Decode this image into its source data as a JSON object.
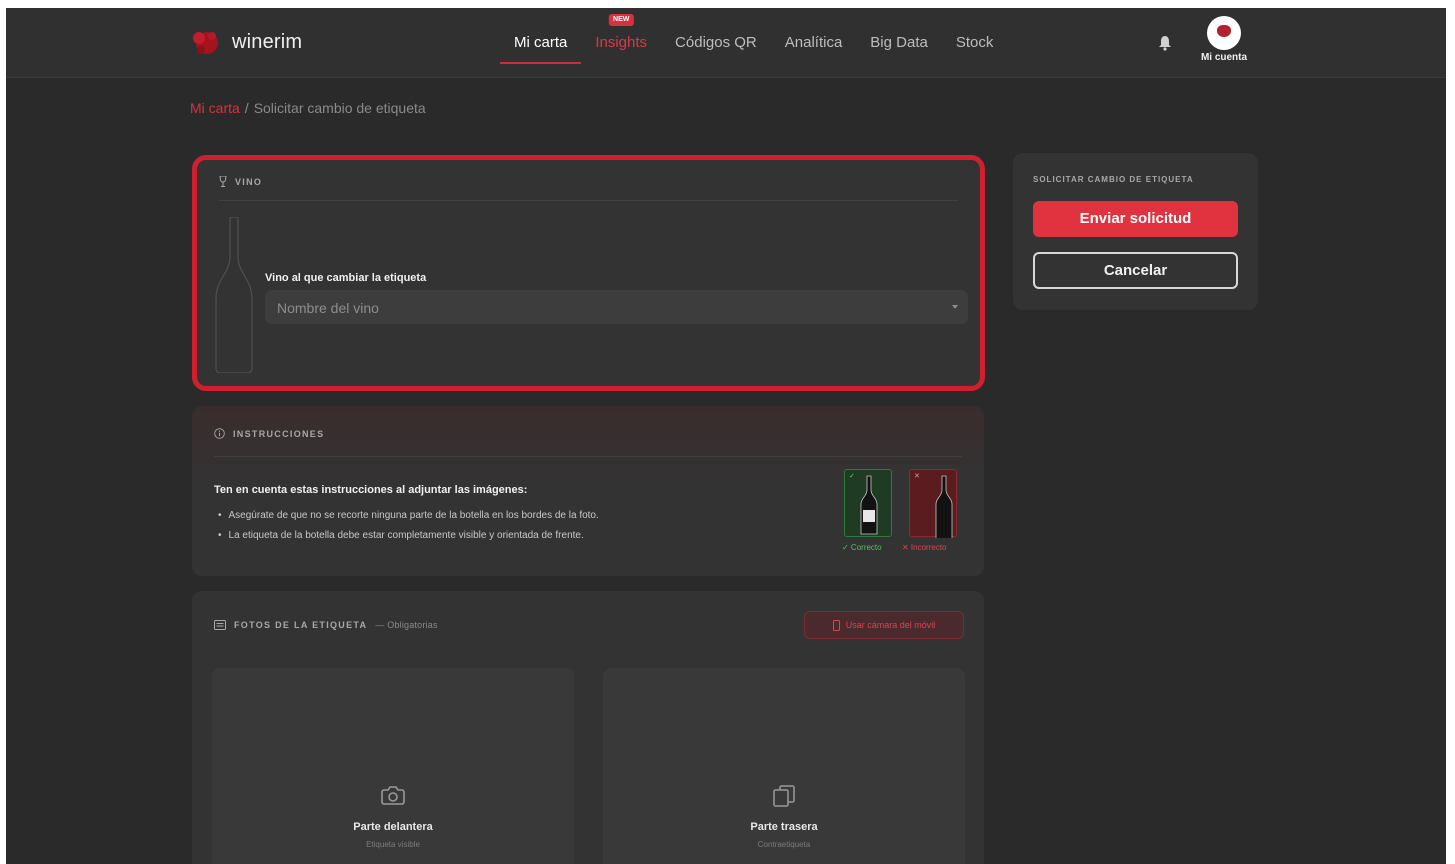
{
  "header": {
    "brand": "winerim",
    "nav": [
      {
        "label": "Mi carta",
        "active": true
      },
      {
        "label": "Insights",
        "badge": "NEW"
      },
      {
        "label": "Códigos QR"
      },
      {
        "label": "Analítica"
      },
      {
        "label": "Big Data"
      },
      {
        "label": "Stock"
      }
    ],
    "account_label": "Mi cuenta"
  },
  "breadcrumb": {
    "root": "Mi carta",
    "separator": "/",
    "current": "Solicitar cambio de etiqueta"
  },
  "vino": {
    "section_title": "VINO",
    "field_label": "Vino al que cambiar la etiqueta",
    "select_placeholder": "Nombre del vino"
  },
  "instrucciones": {
    "section_title": "INSTRUCCIONES",
    "lead": "Ten en cuenta estas instrucciones al adjuntar las imágenes:",
    "items": [
      "Asegúrate de que no se recorte ninguna parte de la botella en los bordes de la foto.",
      "La etiqueta de la botella debe estar completamente visible y orientada de frente."
    ],
    "examples": {
      "correct": "✓ Correcto",
      "incorrect": "✕ Incorrecto"
    }
  },
  "fotos": {
    "section_title": "FOTOS DE LA ETIQUETA",
    "mandatory": "— Obligatorias",
    "camera_button": "Usar cámara del móvil",
    "front": {
      "title": "Parte delantera",
      "subtitle": "Etiqueta visible"
    },
    "back": {
      "title": "Parte trasera",
      "subtitle": "Contraetiqueta"
    }
  },
  "sidebar": {
    "title": "SOLICITAR CAMBIO DE ETIQUETA",
    "submit": "Enviar solicitud",
    "cancel": "Cancelar"
  },
  "colors": {
    "accent": "#e0323f",
    "highlight_border": "#d0202f",
    "background": "#2a2a2a",
    "card": "#333333"
  }
}
